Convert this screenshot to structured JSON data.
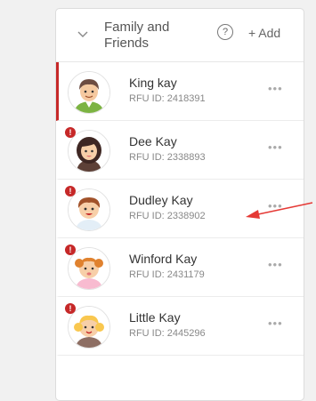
{
  "panel": {
    "title": "Family and Friends",
    "help_symbol": "?",
    "add_label": "+ Add"
  },
  "members": [
    {
      "name": "King kay",
      "rfu": "RFU ID: 2418391",
      "alert": false,
      "active": true
    },
    {
      "name": "Dee Kay",
      "rfu": "RFU ID: 2338893",
      "alert": true,
      "active": false
    },
    {
      "name": "Dudley Kay",
      "rfu": "RFU ID: 2338902",
      "alert": true,
      "active": false
    },
    {
      "name": "Winford Kay",
      "rfu": "RFU ID: 2431179",
      "alert": true,
      "active": false
    },
    {
      "name": "Little Kay",
      "rfu": "RFU ID: 2445296",
      "alert": true,
      "active": false
    }
  ],
  "more_symbol": "•••",
  "alert_symbol": "!",
  "colors": {
    "accent": "#c62828",
    "arrow": "#e53935"
  }
}
